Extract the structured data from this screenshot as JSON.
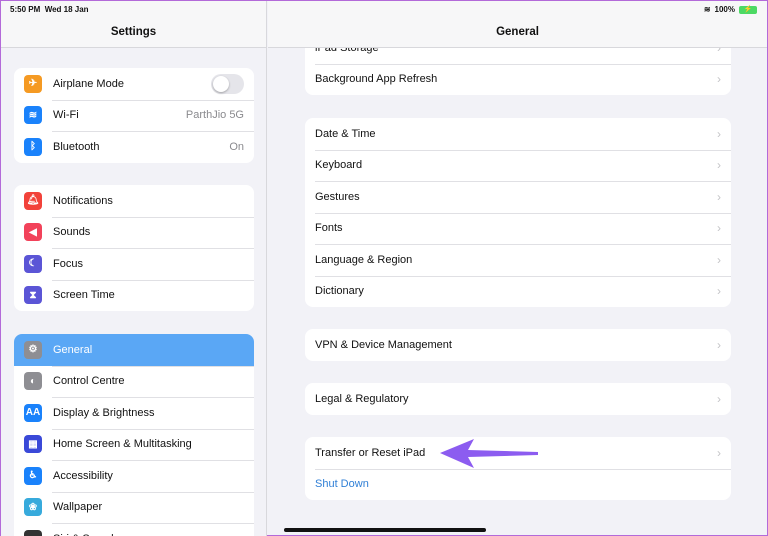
{
  "status": {
    "time": "5:50 PM",
    "date": "Wed 18 Jan",
    "battery": "100%"
  },
  "sidebar": {
    "title": "Settings",
    "group1": [
      {
        "label": "Airplane Mode",
        "icon": "airplane-icon",
        "color": "#f59a23",
        "toggle": false
      },
      {
        "label": "Wi-Fi",
        "icon": "wifi-icon",
        "color": "#1a82fb",
        "value": "ParthJio 5G"
      },
      {
        "label": "Bluetooth",
        "icon": "bluetooth-icon",
        "color": "#1a82fb",
        "value": "On"
      }
    ],
    "group2": [
      {
        "label": "Notifications",
        "icon": "bell-icon",
        "color": "#f2423a"
      },
      {
        "label": "Sounds",
        "icon": "speaker-icon",
        "color": "#f2425a"
      },
      {
        "label": "Focus",
        "icon": "moon-icon",
        "color": "#5b55d6"
      },
      {
        "label": "Screen Time",
        "icon": "hourglass-icon",
        "color": "#5b55d6"
      }
    ],
    "group3": [
      {
        "label": "General",
        "icon": "gear-icon",
        "color": "#8e8e93",
        "selected": true
      },
      {
        "label": "Control Centre",
        "icon": "switches-icon",
        "color": "#8e8e93"
      },
      {
        "label": "Display & Brightness",
        "icon": "text-size-icon",
        "color": "#1a82fb"
      },
      {
        "label": "Home Screen & Multitasking",
        "icon": "grid-icon",
        "color": "#3a49d8"
      },
      {
        "label": "Accessibility",
        "icon": "accessibility-icon",
        "color": "#1a82fb"
      },
      {
        "label": "Wallpaper",
        "icon": "flower-icon",
        "color": "#37aadc"
      },
      {
        "label": "Siri & Search",
        "icon": "siri-icon",
        "color": "#333"
      }
    ]
  },
  "main": {
    "title": "General",
    "groups": [
      [
        "iPad Storage",
        "Background App Refresh"
      ],
      [
        "Date & Time",
        "Keyboard",
        "Gestures",
        "Fonts",
        "Language & Region",
        "Dictionary"
      ],
      [
        "VPN & Device Management"
      ],
      [
        "Legal & Regulatory"
      ],
      [
        "Transfer or Reset iPad"
      ]
    ],
    "shutdown": "Shut Down"
  },
  "annotation_color": "#8c5cf0"
}
